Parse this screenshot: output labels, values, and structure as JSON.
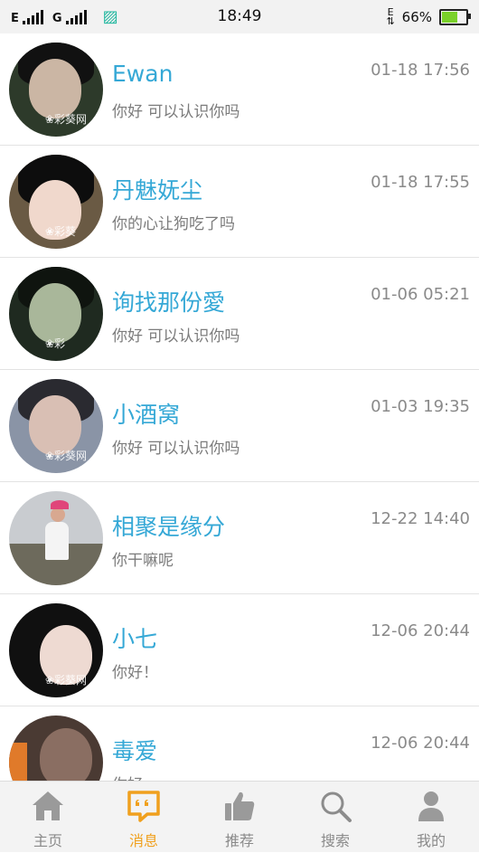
{
  "status_bar": {
    "network_1": "E",
    "network_2": "G",
    "data_indicator": "E",
    "time": "18:49",
    "battery": "66%",
    "battery_level": 0.66
  },
  "messages": [
    {
      "name": "Ewan",
      "preview": "你好 可以认识你吗",
      "time": "01-18 17:56",
      "watermark": "❀彩葵网"
    },
    {
      "name": "丹魅妩尘",
      "preview": "你的心让狗吃了吗",
      "time": "01-18 17:55",
      "watermark": "❀彩葵"
    },
    {
      "name": "询找那份愛",
      "preview": "你好 可以认识你吗",
      "time": "01-06 05:21",
      "watermark": "❀彩"
    },
    {
      "name": "小酒窝",
      "preview": "你好 可以认识你吗",
      "time": "01-03 19:35",
      "watermark": "❀彩葵网"
    },
    {
      "name": "相聚是缘分",
      "preview": "你干嘛呢",
      "time": "12-22 14:40",
      "watermark": ""
    },
    {
      "name": "小七",
      "preview": "你好！",
      "time": "12-06 20:44",
      "watermark": "❀彩葵网"
    },
    {
      "name": "毒爱",
      "preview": "你好",
      "time": "12-06 20:44",
      "watermark": ""
    }
  ],
  "tabs": [
    {
      "label": "主页",
      "icon": "home-icon",
      "active": false
    },
    {
      "label": "消息",
      "icon": "message-icon",
      "active": true
    },
    {
      "label": "推荐",
      "icon": "thumbs-up-icon",
      "active": false
    },
    {
      "label": "搜索",
      "icon": "search-icon",
      "active": false
    },
    {
      "label": "我的",
      "icon": "user-icon",
      "active": false
    }
  ],
  "colors": {
    "accent_name": "#35a8d6",
    "active_tab": "#f0a01e",
    "inactive_tab": "#9a9a9a",
    "battery_fill": "#7ad12a"
  }
}
